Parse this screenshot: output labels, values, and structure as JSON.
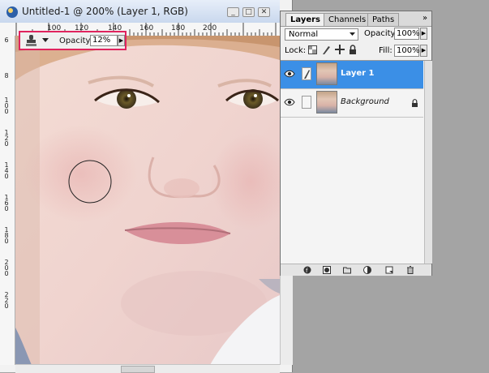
{
  "document": {
    "title": "Untitled-1 @ 200% (Layer 1, RGB)",
    "ruler_top_labels": [
      "100",
      "120",
      "140",
      "160",
      "180",
      "200"
    ],
    "ruler_left_labels": [
      "6",
      "8",
      "1\n0\n0",
      "1\n2\n0",
      "1\n4\n0",
      "1\n6\n0",
      "1\n8\n0",
      "2\n0\n0",
      "2\n2\n0"
    ]
  },
  "options_bar": {
    "tool_icon": "clone-stamp-icon",
    "opacity_label": "Opacity:",
    "opacity_value": "12%"
  },
  "layers_panel": {
    "tabs": [
      "Layers",
      "Channels",
      "Paths"
    ],
    "active_tab": "Layers",
    "blend_mode": "Normal",
    "opacity_label": "Opacity:",
    "opacity_value": "100%",
    "lock_label": "Lock:",
    "fill_label": "Fill:",
    "fill_value": "100%",
    "layers": [
      {
        "name": "Layer 1",
        "selected": true,
        "locked": false
      },
      {
        "name": "Background",
        "selected": false,
        "locked": true
      }
    ],
    "footer_icons": [
      "add-layer-style-icon",
      "add-mask-icon",
      "new-group-icon",
      "new-adjustment-layer-icon",
      "new-layer-icon",
      "delete-layer-icon"
    ]
  },
  "colors": {
    "selected_layer": "#3b8fe6",
    "highlight_border": "#e0245e"
  }
}
